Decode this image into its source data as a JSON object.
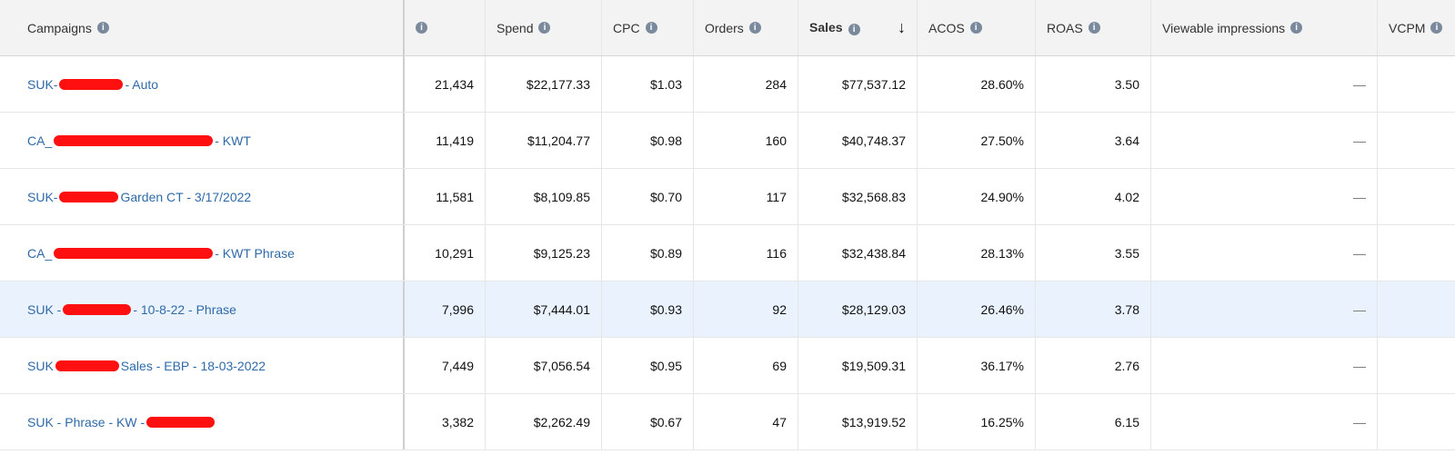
{
  "columns": {
    "campaigns": "Campaigns",
    "impressions": "",
    "spend": "Spend",
    "cpc": "CPC",
    "orders": "Orders",
    "sales": "Sales",
    "acos": "ACOS",
    "roas": "ROAS",
    "viewable": "Viewable impressions",
    "vcpm": "VCPM"
  },
  "rows": [
    {
      "pre": "SUK-",
      "post": " - Auto",
      "impressions": "21,434",
      "spend": "$22,177.33",
      "cpc": "$1.03",
      "orders": "284",
      "sales": "$77,537.12",
      "acos": "28.60%",
      "roas": "3.50",
      "viewable": "—",
      "vcpm": ""
    },
    {
      "pre": "CA_",
      "post": " - KWT",
      "impressions": "11,419",
      "spend": "$11,204.77",
      "cpc": "$0.98",
      "orders": "160",
      "sales": "$40,748.37",
      "acos": "27.50%",
      "roas": "3.64",
      "viewable": "—",
      "vcpm": ""
    },
    {
      "pre": "SUK-",
      "post": " Garden CT - 3/17/2022",
      "impressions": "11,581",
      "spend": "$8,109.85",
      "cpc": "$0.70",
      "orders": "117",
      "sales": "$32,568.83",
      "acos": "24.90%",
      "roas": "4.02",
      "viewable": "—",
      "vcpm": ""
    },
    {
      "pre": "CA_",
      "post": " - KWT Phrase",
      "impressions": "10,291",
      "spend": "$9,125.23",
      "cpc": "$0.89",
      "orders": "116",
      "sales": "$32,438.84",
      "acos": "28.13%",
      "roas": "3.55",
      "viewable": "—",
      "vcpm": ""
    },
    {
      "pre": "SUK -",
      "post": " - 10-8-22 - Phrase",
      "impressions": "7,996",
      "spend": "$7,444.01",
      "cpc": "$0.93",
      "orders": "92",
      "sales": "$28,129.03",
      "acos": "26.46%",
      "roas": "3.78",
      "viewable": "—",
      "vcpm": ""
    },
    {
      "pre": "SUK",
      "post": "Sales - EBP - 18-03-2022",
      "impressions": "7,449",
      "spend": "$7,056.54",
      "cpc": "$0.95",
      "orders": "69",
      "sales": "$19,509.31",
      "acos": "36.17%",
      "roas": "2.76",
      "viewable": "—",
      "vcpm": ""
    },
    {
      "pre": "SUK - Phrase - KW -",
      "post": "",
      "impressions": "3,382",
      "spend": "$2,262.49",
      "cpc": "$0.67",
      "orders": "47",
      "sales": "$13,919.52",
      "acos": "16.25%",
      "roas": "6.15",
      "viewable": "—",
      "vcpm": ""
    }
  ]
}
